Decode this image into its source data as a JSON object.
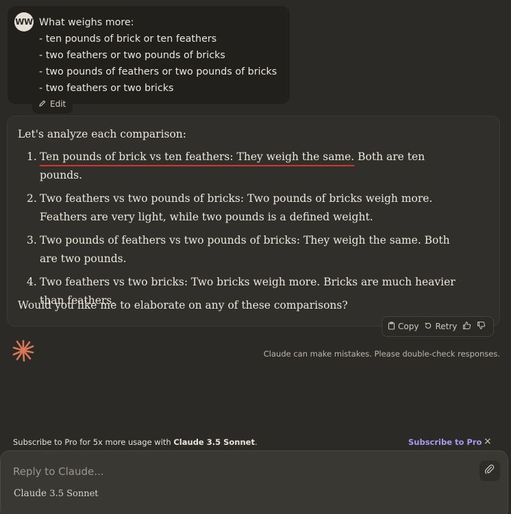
{
  "user": {
    "avatar": "WW",
    "lines": [
      "What weighs more:",
      "- ten pounds of brick or ten feathers",
      "- two feathers or two pounds of bricks",
      "- two pounds of feathers or two pounds of bricks",
      "- two feathers or two bricks"
    ],
    "edit_label": "Edit"
  },
  "assistant": {
    "intro": "Let's analyze each comparison:",
    "items": [
      {
        "num": "1.",
        "underlined": "Ten pounds of brick vs ten feathers: They weigh the same.",
        "rest": " Both are ten pounds."
      },
      {
        "num": "2.",
        "text": "Two feathers vs two pounds of bricks: Two pounds of bricks weigh more. Feathers are very light, while two pounds is a defined weight."
      },
      {
        "num": "3.",
        "text": "Two pounds of feathers vs two pounds of bricks: They weigh the same. Both are two pounds."
      },
      {
        "num": "4.",
        "text": "Two feathers vs two bricks: Two bricks weigh more. Bricks are much heavier than feathers."
      }
    ],
    "outro": "Would you like me to elaborate on any of these comparisons?"
  },
  "actions": {
    "copy": "Copy",
    "retry": "Retry",
    "thumbs_up_icon": "thumbs-up-icon",
    "thumbs_down_icon": "thumbs-down-icon"
  },
  "disclaimer": "Claude can make mistakes. Please double-check responses.",
  "promo": {
    "text": "Subscribe to Pro for 5x more usage with ",
    "model_bold": "Claude 3.5 Sonnet",
    "period": ".",
    "link": "Subscribe to Pro",
    "close": "×"
  },
  "composer": {
    "placeholder": "Reply to Claude...",
    "model_name": "Claude",
    "model_version": "3.5 Sonnet"
  },
  "colors": {
    "background": "#2b2a27",
    "accent_orange": "#d97757",
    "underline_red": "#d9342b",
    "link_purple": "#a89cf0"
  }
}
